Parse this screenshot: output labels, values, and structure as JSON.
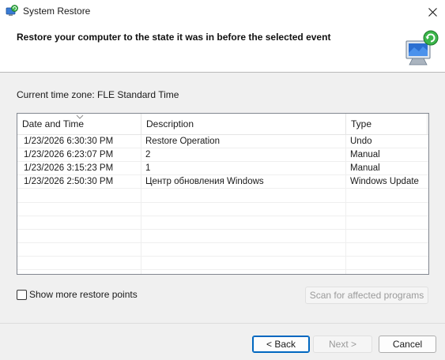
{
  "window": {
    "title": "System Restore",
    "icon": "system-restore-icon",
    "close_icon": "close-icon"
  },
  "header": {
    "title": "Restore your computer to the state it was in before the selected event",
    "icon": "restore-monitor-icon"
  },
  "timezone_label": "Current time zone: FLE Standard Time",
  "table": {
    "columns": [
      "Date and Time",
      "Description",
      "Type"
    ],
    "sort_indicator": "chevron-down-icon",
    "rows": [
      {
        "date": "1/23/2026 6:30:30 PM",
        "description": "Restore Operation",
        "type": "Undo"
      },
      {
        "date": "1/23/2026 6:23:07 PM",
        "description": "2",
        "type": "Manual"
      },
      {
        "date": "1/23/2026 3:15:23 PM",
        "description": "1",
        "type": "Manual"
      },
      {
        "date": "1/23/2026 2:50:30 PM",
        "description": "Центр обновления Windows",
        "type": "Windows Update"
      }
    ]
  },
  "show_more": {
    "label": "Show more restore points",
    "checked": false
  },
  "buttons": {
    "scan": "Scan for affected programs",
    "back": "< Back",
    "next": "Next >",
    "cancel": "Cancel"
  },
  "colors": {
    "accent": "#0067c0",
    "header_bg": "#ffffff",
    "body_bg": "#f0f0f0"
  }
}
